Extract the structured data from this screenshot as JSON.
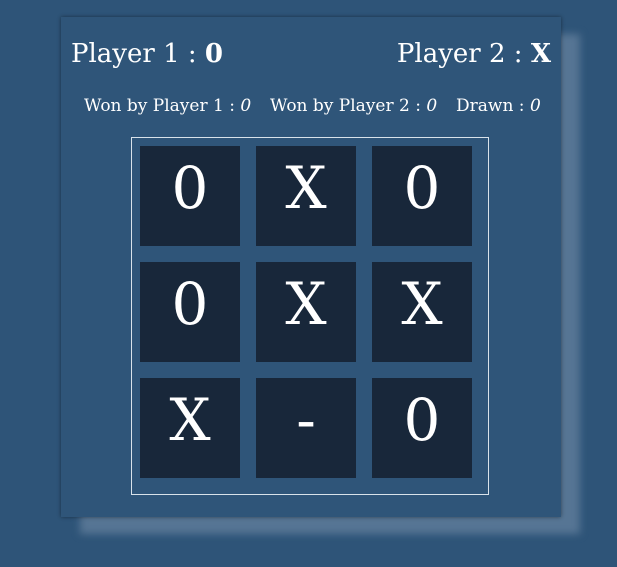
{
  "players": {
    "player1": {
      "label": "Player 1 :",
      "mark": "0"
    },
    "player2": {
      "label": "Player 2 :",
      "mark": "X"
    }
  },
  "stats": {
    "won_p1": {
      "label": "Won by Player 1 :",
      "value": "0"
    },
    "won_p2": {
      "label": "Won by Player 2 :",
      "value": "0"
    },
    "drawn": {
      "label": "Drawn :",
      "value": "0"
    }
  },
  "board": {
    "cells": [
      "0",
      "X",
      "0",
      "0",
      "X",
      "X",
      "X",
      "-",
      "0"
    ]
  }
}
